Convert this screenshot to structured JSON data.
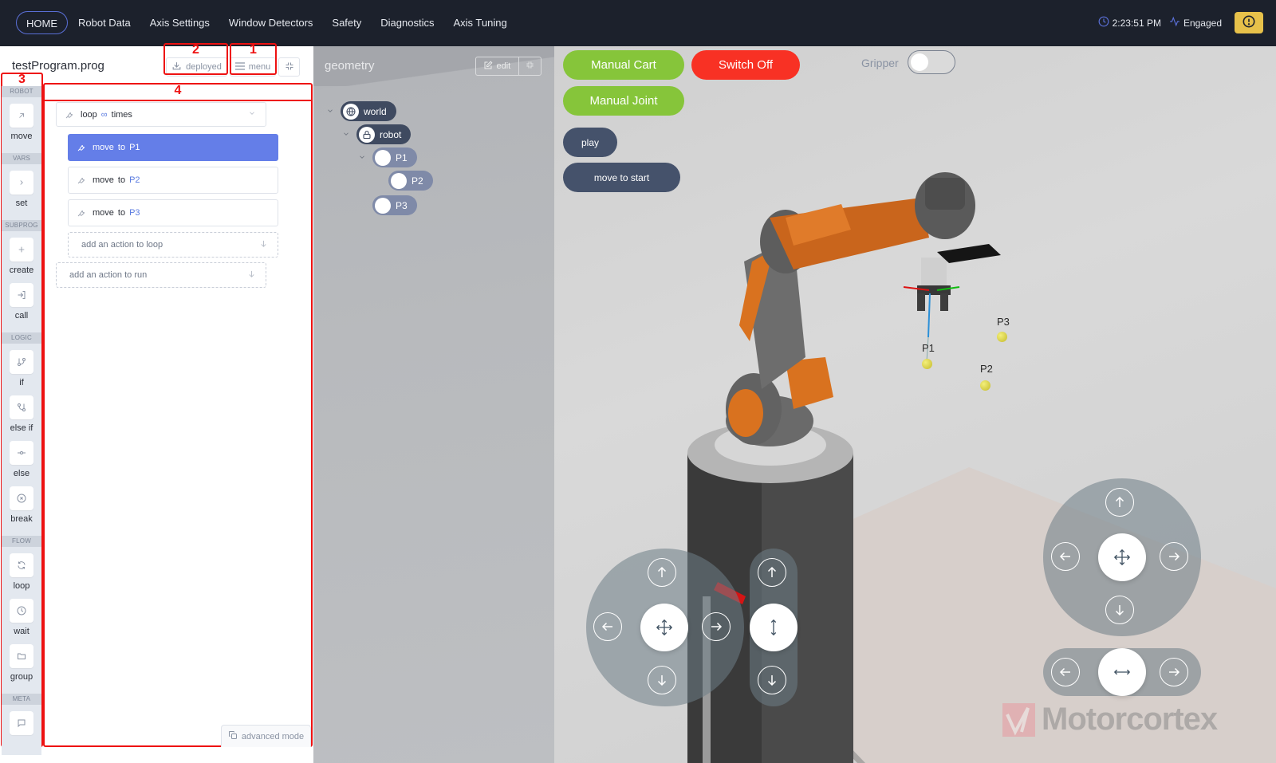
{
  "nav": {
    "items": [
      {
        "label": "HOME",
        "active": true
      },
      {
        "label": "Robot Data"
      },
      {
        "label": "Axis Settings"
      },
      {
        "label": "Window Detectors"
      },
      {
        "label": "Safety"
      },
      {
        "label": "Diagnostics"
      },
      {
        "label": "Axis Tuning"
      }
    ]
  },
  "status": {
    "time": "2:23:51 PM",
    "state": "Engaged",
    "clock_icon": "clock-icon",
    "activity_icon": "activity-icon",
    "alert_icon": "alert-circle-icon",
    "alert_color": "#e7c14a"
  },
  "program": {
    "filename": "testProgram.prog",
    "deployed_label": "deployed",
    "menu_label": "menu",
    "advanced_mode_label": "advanced mode"
  },
  "annotations": [
    "1",
    "2",
    "3",
    "4"
  ],
  "palette": {
    "sections": [
      {
        "title": "ROBOT",
        "items": [
          {
            "label": "move",
            "icon": "arrow-up-right-icon"
          }
        ]
      },
      {
        "title": "VARS",
        "items": [
          {
            "label": "set",
            "icon": "chevron-right-icon"
          }
        ]
      },
      {
        "title": "SUBPROG",
        "items": [
          {
            "label": "create",
            "icon": "plus-icon"
          },
          {
            "label": "call",
            "icon": "log-in-icon"
          }
        ]
      },
      {
        "title": "LOGIC",
        "items": [
          {
            "label": "if",
            "icon": "git-branch-icon"
          },
          {
            "label": "else if",
            "icon": "git-merge-icon"
          },
          {
            "label": "else",
            "icon": "git-commit-icon"
          },
          {
            "label": "break",
            "icon": "x-circle-icon"
          }
        ]
      },
      {
        "title": "FLOW",
        "items": [
          {
            "label": "loop",
            "icon": "refresh-icon"
          },
          {
            "label": "wait",
            "icon": "clock-icon"
          },
          {
            "label": "group",
            "icon": "folder-icon"
          }
        ]
      },
      {
        "title": "META",
        "items": [
          {
            "label": "",
            "icon": "message-square-icon"
          }
        ]
      }
    ]
  },
  "tree": {
    "loop": {
      "keyword": "loop",
      "count": "∞",
      "suffix": "times"
    },
    "actions": [
      {
        "keyword": "move",
        "prep": "to",
        "target": "P1",
        "selected": true
      },
      {
        "keyword": "move",
        "prep": "to",
        "target": "P2",
        "selected": false
      },
      {
        "keyword": "move",
        "prep": "to",
        "target": "P3",
        "selected": false
      }
    ],
    "add_to_loop": "add an action to loop",
    "add_to_run": "add an action to run"
  },
  "geometry": {
    "title": "geometry",
    "edit_label": "edit",
    "nodes": [
      {
        "label": "world",
        "icon": "globe-icon"
      },
      {
        "label": "robot",
        "icon": "lock-icon"
      },
      {
        "label": "P1"
      },
      {
        "label": "P2"
      },
      {
        "label": "P3"
      }
    ]
  },
  "controls": {
    "manual_cart": "Manual Cart",
    "switch_off": "Switch Off",
    "manual_joint": "Manual Joint",
    "play": "play",
    "move_to_start": "move to start",
    "gripper_label": "Gripper",
    "gripper_on": false,
    "colors": {
      "green": "#86c53a",
      "red": "#f83124",
      "slate": "#45526b",
      "accent": "#647ee8"
    }
  },
  "scene": {
    "points": [
      "P1",
      "P2",
      "P3"
    ],
    "logo_text": "Motorcortex"
  }
}
